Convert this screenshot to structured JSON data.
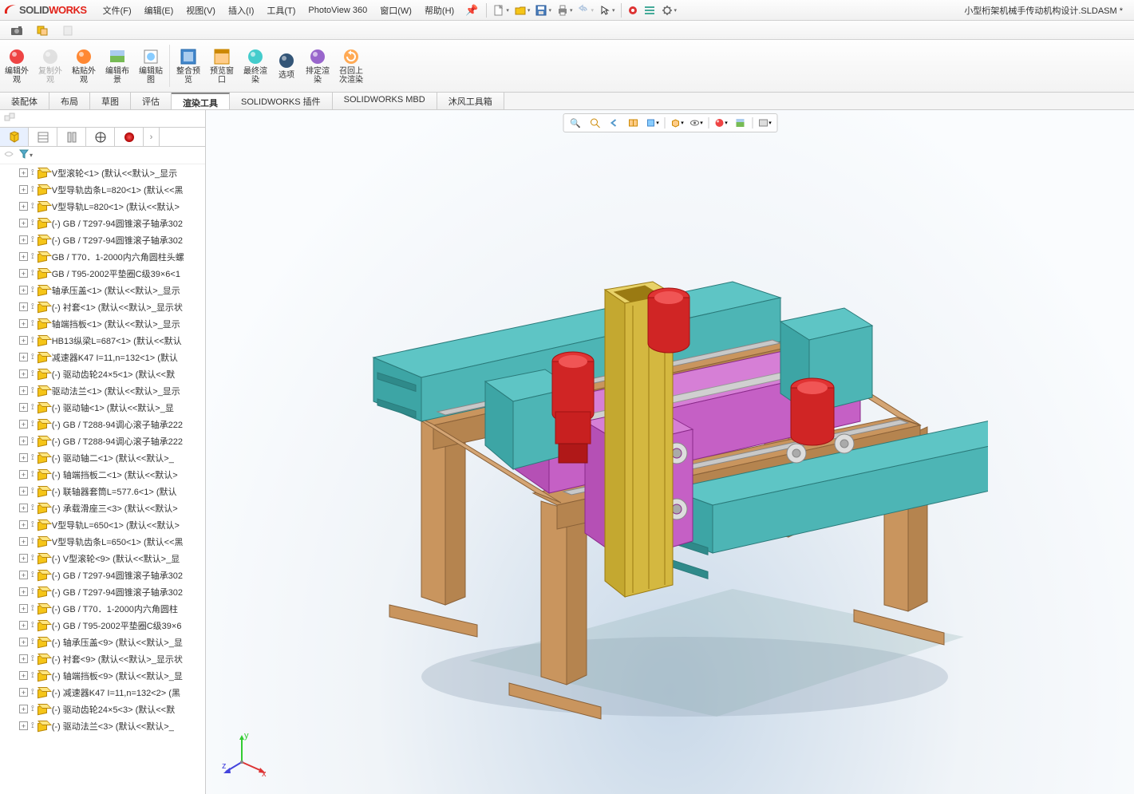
{
  "app": {
    "name_solid": "SOLID",
    "name_works": "WORKS",
    "ds": "DS"
  },
  "doc_title": "小型桁架机械手传动机构设计.SLDASM *",
  "menu": [
    "文件(F)",
    "编辑(E)",
    "视图(V)",
    "插入(I)",
    "工具(T)",
    "PhotoView 360",
    "窗口(W)",
    "帮助(H)"
  ],
  "ribbon": [
    {
      "label": "编辑外\n观",
      "icon": "sphere-red"
    },
    {
      "label": "复制外\n观",
      "icon": "sphere-grey",
      "disabled": true
    },
    {
      "label": "粘贴外\n观",
      "icon": "sphere-orange"
    },
    {
      "label": "编辑布\n景",
      "icon": "scene-green"
    },
    {
      "label": "编辑贴\n图",
      "icon": "decal"
    },
    {
      "label": "整合预\n览",
      "icon": "preview-blue",
      "sep_before": true
    },
    {
      "label": "预览窗\n口",
      "icon": "window-orange"
    },
    {
      "label": "最终渲\n染",
      "icon": "sphere-cyan"
    },
    {
      "label": "选项",
      "icon": "sphere-navy"
    },
    {
      "label": "排定渲\n染",
      "icon": "sphere-purple"
    },
    {
      "label": "召回上\n次渲染",
      "icon": "recall"
    }
  ],
  "tabs": [
    "装配体",
    "布局",
    "草图",
    "评估",
    "渲染工具",
    "SOLIDWORKS 插件",
    "SOLIDWORKS MBD",
    "沐风工具箱"
  ],
  "active_tab": 4,
  "tree": [
    "V型滚轮<1> (默认<<默认>_显示",
    "V型导轨齿条L=820<1> (默认<<黑",
    "V型导轨L=820<1> (默认<<默认>",
    "(-) GB / T297-94圆锥滚子轴承302",
    "(-) GB / T297-94圆锥滚子轴承302",
    "GB / T70．1-2000内六角圆柱头螺",
    "GB / T95-2002平垫圈C级39×6<1",
    "轴承压盖<1> (默认<<默认>_显示",
    "(-) 衬套<1> (默认<<默认>_显示状",
    "轴端挡板<1> (默认<<默认>_显示",
    "HB13纵梁L=687<1> (默认<<默认",
    "减速器K47 I=11,n=132<1> (默认",
    "(-) 驱动齿轮24×5<1> (默认<<默",
    "驱动法兰<1> (默认<<默认>_显示",
    "(-) 驱动轴<1> (默认<<默认>_显",
    "(-) GB / T288-94调心滚子轴承222",
    "(-) GB / T288-94调心滚子轴承222",
    "(-) 驱动轴二<1> (默认<<默认>_",
    "(-) 轴端挡板二<1> (默认<<默认>",
    "(-) 联轴器套筒L=577.6<1> (默认",
    "(-) 承载滑座三<3> (默认<<默认>",
    "V型导轨L=650<1> (默认<<默认>",
    "V型导轨齿条L=650<1> (默认<<黑",
    "(-) V型滚轮<9> (默认<<默认>_显",
    "(-) GB / T297-94圆锥滚子轴承302",
    "(-) GB / T297-94圆锥滚子轴承302",
    "(-) GB / T70．1-2000内六角圆柱",
    "(-) GB / T95-2002平垫圈C级39×6",
    "(-) 轴承压盖<9> (默认<<默认>_显",
    "(-) 衬套<9> (默认<<默认>_显示状",
    "(-) 轴端挡板<9> (默认<<默认>_显",
    "(-) 减速器K47 I=11,n=132<2> (黑",
    "(-) 驱动齿轮24×5<3> (默认<<默",
    "(-) 驱动法兰<3> (默认<<默认>_"
  ],
  "triad": {
    "x": "x",
    "y": "y",
    "z": "z"
  }
}
